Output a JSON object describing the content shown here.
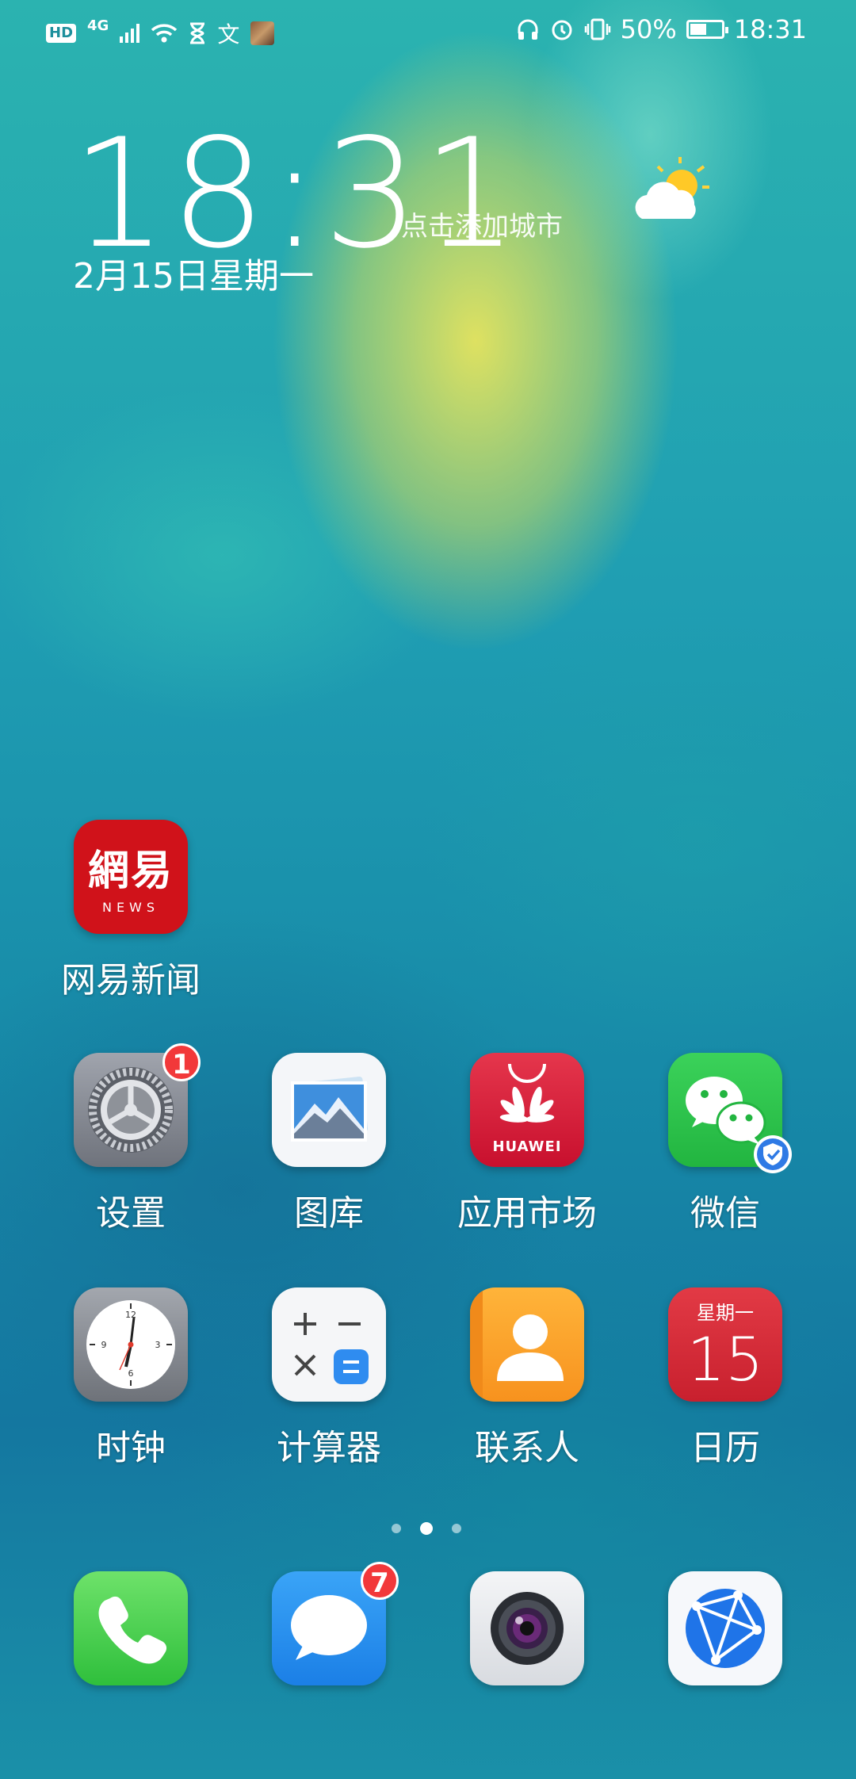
{
  "status_bar": {
    "hd": "HD",
    "network": "4G",
    "battery": "50%",
    "time": "18:31"
  },
  "lockclock": {
    "time": "18:31",
    "date": "2月15日星期一",
    "city_prompt": "点击添加城市",
    "weather_icon": "partly-cloudy-icon"
  },
  "apps": {
    "netease": {
      "label": "网易新闻",
      "icon_text": "網易",
      "icon_sub": "NEWS"
    },
    "settings": {
      "label": "设置",
      "badge": "1"
    },
    "gallery": {
      "label": "图库"
    },
    "appmarket": {
      "label": "应用市场",
      "brand": "HUAWEI"
    },
    "wechat": {
      "label": "微信"
    },
    "clock": {
      "label": "时钟"
    },
    "calculator": {
      "label": "计算器"
    },
    "contacts": {
      "label": "联系人"
    },
    "calendar": {
      "label": "日历",
      "weekday": "星期一",
      "day": "15"
    }
  },
  "dock": {
    "phone": {
      "icon": "phone-icon"
    },
    "messages": {
      "icon": "message-icon",
      "badge": "7"
    },
    "camera": {
      "icon": "camera-icon"
    },
    "browser": {
      "icon": "globe-icon"
    }
  },
  "page_indicator": {
    "pages": 3,
    "current": 2
  },
  "colors": {
    "badge": "#f2383a",
    "netease_red": "#d0121a",
    "wechat_green": "#2fc84a"
  }
}
